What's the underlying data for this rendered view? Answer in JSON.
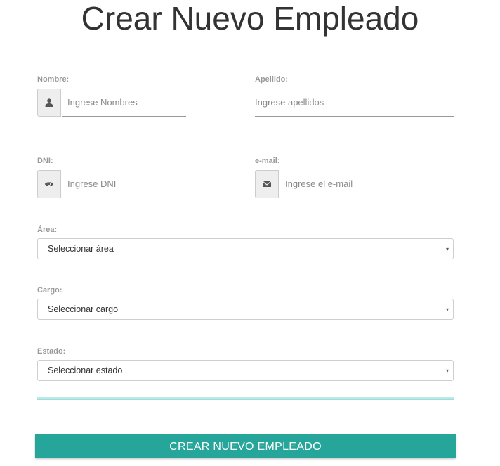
{
  "page": {
    "title": "Crear Nuevo Empleado"
  },
  "form": {
    "nombre": {
      "label": "Nombre:",
      "placeholder": "Ingrese Nombres",
      "icon": "user-icon"
    },
    "apellido": {
      "label": "Apellido:",
      "placeholder": "Ingrese apellidos"
    },
    "dni": {
      "label": "DNI:",
      "placeholder": "Ingrese DNI",
      "icon": "eye-icon"
    },
    "email": {
      "label": "e-mail:",
      "placeholder": "Ingrese el e-mail",
      "icon": "envelope-icon"
    },
    "area": {
      "label": "Área:",
      "selected": "Seleccionar área"
    },
    "cargo": {
      "label": "Cargo:",
      "selected": "Seleccionar cargo"
    },
    "estado": {
      "label": "Estado:",
      "selected": "Seleccionar estado"
    },
    "caret": "▾",
    "submit_label": "CREAR NUEVO EMPLEADO"
  },
  "colors": {
    "accent": "#26a69a",
    "divider": "#b7ebe7"
  }
}
